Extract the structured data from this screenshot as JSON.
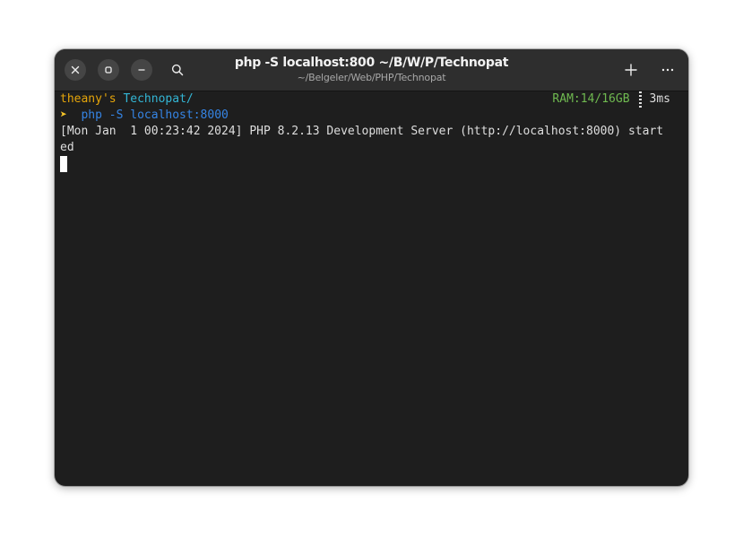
{
  "window": {
    "title": "php -S localhost:800 ~/B/W/P/Technopat",
    "subtitle": "~/Belgeler/Web/PHP/Technopat"
  },
  "headerbar": {
    "left_icons": [
      "close-icon",
      "maximize-icon",
      "minimize-icon",
      "search-icon"
    ],
    "right_icons": [
      "new-tab-icon",
      "menu-icon"
    ]
  },
  "terminal": {
    "prompt": {
      "user": "theany's",
      "dir": "Technopat/",
      "ram": "RAM:14/16GB",
      "duration": "3ms",
      "arrow": "➤",
      "command": "php -S localhost:8000"
    },
    "output_line1": "[Mon Jan  1 00:23:42 2024] PHP 8.2.13 Development Server (http://localhost:8000) start",
    "output_line2": "ed"
  },
  "colors": {
    "user": "#e5a50a",
    "dir": "#33b5d4",
    "command": "#3584e4",
    "ram": "#6fb950",
    "background": "#1e1e1e",
    "headerbar": "#2e2e2e"
  }
}
